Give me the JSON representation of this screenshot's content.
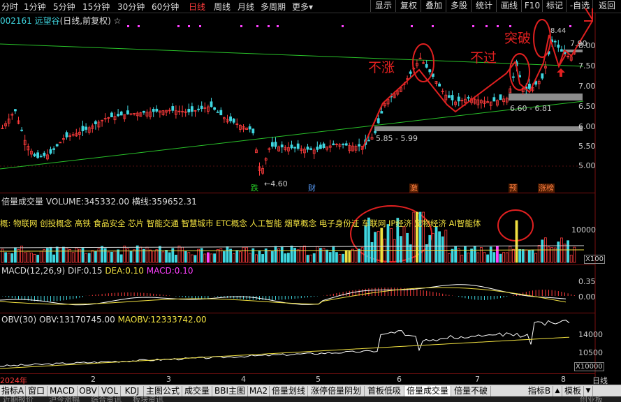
{
  "toolbar": {
    "periods": [
      "分时",
      "1分钟",
      "5分钟",
      "15分钟",
      "30分钟",
      "60分钟",
      "日线",
      "周线",
      "月线",
      "多周期",
      "更多"
    ],
    "active_period": "日线",
    "more_arrow": "▾",
    "right_buttons": [
      "显示",
      "复权",
      "叠加",
      "多股",
      "统计",
      "画线",
      "F10",
      "标记",
      "-自选",
      "返回"
    ]
  },
  "stock": {
    "code_name": "002161 远望谷",
    "mode": "(日线,前复权)",
    "star": "☆"
  },
  "price_axis": [
    "8.00",
    "7.50",
    "7.00",
    "6.50",
    "6.00",
    "5.50",
    "5.00"
  ],
  "price_labels": {
    "high_marker": "8.44",
    "last": "7.90",
    "zone_high": "6.60 - 6.81",
    "zone_low": "5.85 - 5.99",
    "low": "4.60"
  },
  "event_badges": [
    {
      "text": "跌",
      "color": "#29d629"
    },
    {
      "text": "财",
      "color": "#5aa0ff"
    },
    {
      "text": "激",
      "color": "#ff8040"
    },
    {
      "text": "预",
      "color": "#ff8040"
    },
    {
      "text": "涨榜",
      "color": "#ff8040"
    }
  ],
  "annotations": {
    "no_rise": "不涨",
    "no_pass": "不过",
    "breakout": "突破"
  },
  "volume": {
    "name": "倍量成交量",
    "volume_label": "VOLUME:",
    "volume_value": "345332.00",
    "hline_label": "横线:",
    "hline_value": "359652.31",
    "concepts_prefix": "概:",
    "concepts": "物联网 创投概念 高铁 食品安全 芯片 智能交通 智慧城市 ETC概念 人工智能 烟草概念 电子身份证 车联网 IP经济 宠物经济 AI智能体",
    "axis_value": "10000",
    "axis_unit": "X100"
  },
  "macd": {
    "name": "MACD(12,26,9)",
    "dif_label": "DIF:",
    "dif_value": "0.15",
    "dea_label": "DEA:",
    "dea_value": "0.10",
    "macd_label": "MACD:",
    "macd_value": "0.10",
    "axis": [
      "0.35",
      "0.00"
    ]
  },
  "obv": {
    "name": "OBV(30)",
    "obv_label": "OBV:",
    "obv_value": "13170745.00",
    "maobv_label": "MAOBV:",
    "maobv_value": "12333742.00",
    "axis": [
      "14000",
      "10500"
    ],
    "axis_unit": "X10000"
  },
  "time_axis": {
    "year": "2024年",
    "months": [
      "2",
      "3",
      "4",
      "5",
      "6",
      "7",
      "8"
    ],
    "period": "日线"
  },
  "bottom_tabs": [
    "指标A",
    "窗口",
    "MACD",
    "OBV",
    "VOL",
    "KDJ",
    "主图公式",
    "成交量",
    "BBI主图",
    "MA2",
    "倍量划线",
    "涨停倍量阴划",
    "首板低吸",
    "倍量成交量",
    "倍量不破"
  ],
  "bottom_right": {
    "b": "指标B",
    "up": "▲",
    "mode": "模板",
    "down": "▼"
  },
  "status_items": [
    "近期报价",
    "沪今涨幅",
    "综合资讯",
    "板块资讯",
    "创业板"
  ],
  "colors": {
    "up": "#ff3c3c",
    "down": "#3fd6e0",
    "accent": "#ff3c3c",
    "ma_green": "#29c229"
  }
}
